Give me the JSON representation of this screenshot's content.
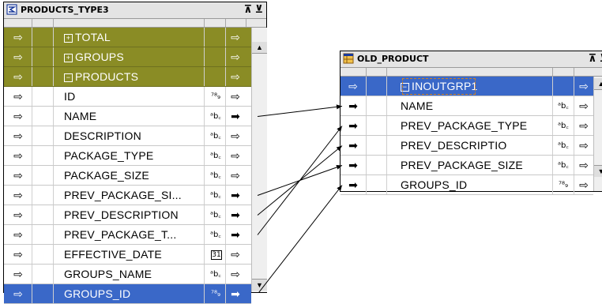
{
  "source": {
    "title": "PRODUCTS_TYPE3",
    "maximize_label": "⊼",
    "minimize_label": "⊻",
    "rows": [
      {
        "kind": "group",
        "name": "TOTAL",
        "expander": "+",
        "in": "⇨",
        "out": "⇨",
        "dtype": ""
      },
      {
        "kind": "group",
        "name": "GROUPS",
        "expander": "+",
        "in": "⇨",
        "out": "⇨",
        "dtype": ""
      },
      {
        "kind": "group",
        "name": "PRODUCTS",
        "expander": "−",
        "in": "⇨",
        "out": "⇨",
        "dtype": ""
      },
      {
        "kind": "attr",
        "name": "ID",
        "in": "⇨",
        "out": "⇨",
        "dtype": "⁷⁸₉"
      },
      {
        "kind": "attr",
        "name": "NAME",
        "in": "⇨",
        "out": "➡",
        "dtype": "ᵃb꜀"
      },
      {
        "kind": "attr",
        "name": "DESCRIPTION",
        "in": "⇨",
        "out": "⇨",
        "dtype": "ᵃb꜀"
      },
      {
        "kind": "attr",
        "name": "PACKAGE_TYPE",
        "in": "⇨",
        "out": "⇨",
        "dtype": "ᵃb꜀"
      },
      {
        "kind": "attr",
        "name": "PACKAGE_SIZE",
        "in": "⇨",
        "out": "⇨",
        "dtype": "ᵃb꜀"
      },
      {
        "kind": "attr",
        "name": "PREV_PACKAGE_SI...",
        "in": "⇨",
        "out": "➡",
        "dtype": "ᵃb꜀"
      },
      {
        "kind": "attr",
        "name": "PREV_DESCRIPTION",
        "in": "⇨",
        "out": "➡",
        "dtype": "ᵃb꜀"
      },
      {
        "kind": "attr",
        "name": "PREV_PACKAGE_T...",
        "in": "⇨",
        "out": "➡",
        "dtype": "ᵃb꜀"
      },
      {
        "kind": "attr",
        "name": "EFFECTIVE_DATE",
        "in": "⇨",
        "out": "⇨",
        "dtype": "31"
      },
      {
        "kind": "attr",
        "name": "GROUPS_NAME",
        "in": "⇨",
        "out": "⇨",
        "dtype": "ᵃb꜀"
      },
      {
        "kind": "attr",
        "name": "GROUPS_ID",
        "in": "⇨",
        "out": "➡",
        "dtype": "⁷⁸₉",
        "selected": true
      }
    ]
  },
  "target": {
    "title": "OLD_PRODUCT",
    "maximize_label": "⊼",
    "minimize_label": "⊻",
    "rows": [
      {
        "kind": "group",
        "name": "INOUTGRP1",
        "expander": "−",
        "in": "⇨",
        "out": "⇨",
        "dtype": "",
        "selected": true
      },
      {
        "kind": "attr",
        "name": "NAME",
        "in": "➡",
        "out": "⇨",
        "dtype": "ᵃb꜀"
      },
      {
        "kind": "attr",
        "name": "PREV_PACKAGE_TYPE",
        "in": "➡",
        "out": "⇨",
        "dtype": "ᵃb꜀"
      },
      {
        "kind": "attr",
        "name": "PREV_DESCRIPTIO",
        "in": "➡",
        "out": "⇨",
        "dtype": "ᵃb꜀"
      },
      {
        "kind": "attr",
        "name": "PREV_PACKAGE_SIZE",
        "in": "➡",
        "out": "⇨",
        "dtype": "ᵃb꜀"
      },
      {
        "kind": "attr",
        "name": "GROUPS_ID",
        "in": "➡",
        "out": "⇨",
        "dtype": "⁷⁸₉"
      }
    ]
  },
  "connections": [
    {
      "from": "NAME",
      "to": "NAME"
    },
    {
      "from": "PREV_PACKAGE_SI...",
      "to": "PREV_PACKAGE_SIZE"
    },
    {
      "from": "PREV_DESCRIPTION",
      "to": "PREV_DESCRIPTIO"
    },
    {
      "from": "PREV_PACKAGE_T...",
      "to": "PREV_PACKAGE_TYPE"
    },
    {
      "from": "GROUPS_ID",
      "to": "GROUPS_ID"
    }
  ],
  "colors": {
    "group_row": "#8a8c25",
    "selected_row": "#3a68c8"
  }
}
